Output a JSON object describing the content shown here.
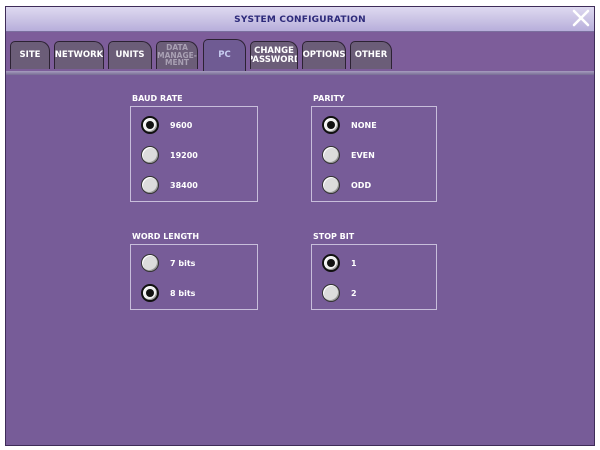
{
  "window": {
    "title": "SYSTEM CONFIGURATION"
  },
  "tabs": [
    {
      "id": "site",
      "label": "SITE"
    },
    {
      "id": "network",
      "label": "NETWORK"
    },
    {
      "id": "units",
      "label": "UNITS"
    },
    {
      "id": "data-management",
      "label": "DATA\nMANAGE-\nMENT"
    },
    {
      "id": "pc",
      "label": "PC"
    },
    {
      "id": "change-password",
      "label": "CHANGE\nPASSWORD"
    },
    {
      "id": "options",
      "label": "OPTIONS"
    },
    {
      "id": "other",
      "label": "OTHER"
    }
  ],
  "active_tab": "PC",
  "baud_rate": {
    "label": "BAUD RATE",
    "options": [
      "9600",
      "19200",
      "38400"
    ],
    "selected": "9600"
  },
  "parity": {
    "label": "PARITY",
    "options": [
      "NONE",
      "EVEN",
      "ODD"
    ],
    "selected": "NONE"
  },
  "word_length": {
    "label": "WORD LENGTH",
    "options": [
      "7 bits",
      "8 bits"
    ],
    "selected": "8 bits"
  },
  "stop_bit": {
    "label": "STOP BIT",
    "options": [
      "1",
      "2"
    ],
    "selected": "1"
  },
  "colors": {
    "background": "#775c98",
    "titlebar": "#ded9f0",
    "title_text": "#2d2a7a",
    "tab": "#6b5d78",
    "text": "#ffffff"
  }
}
